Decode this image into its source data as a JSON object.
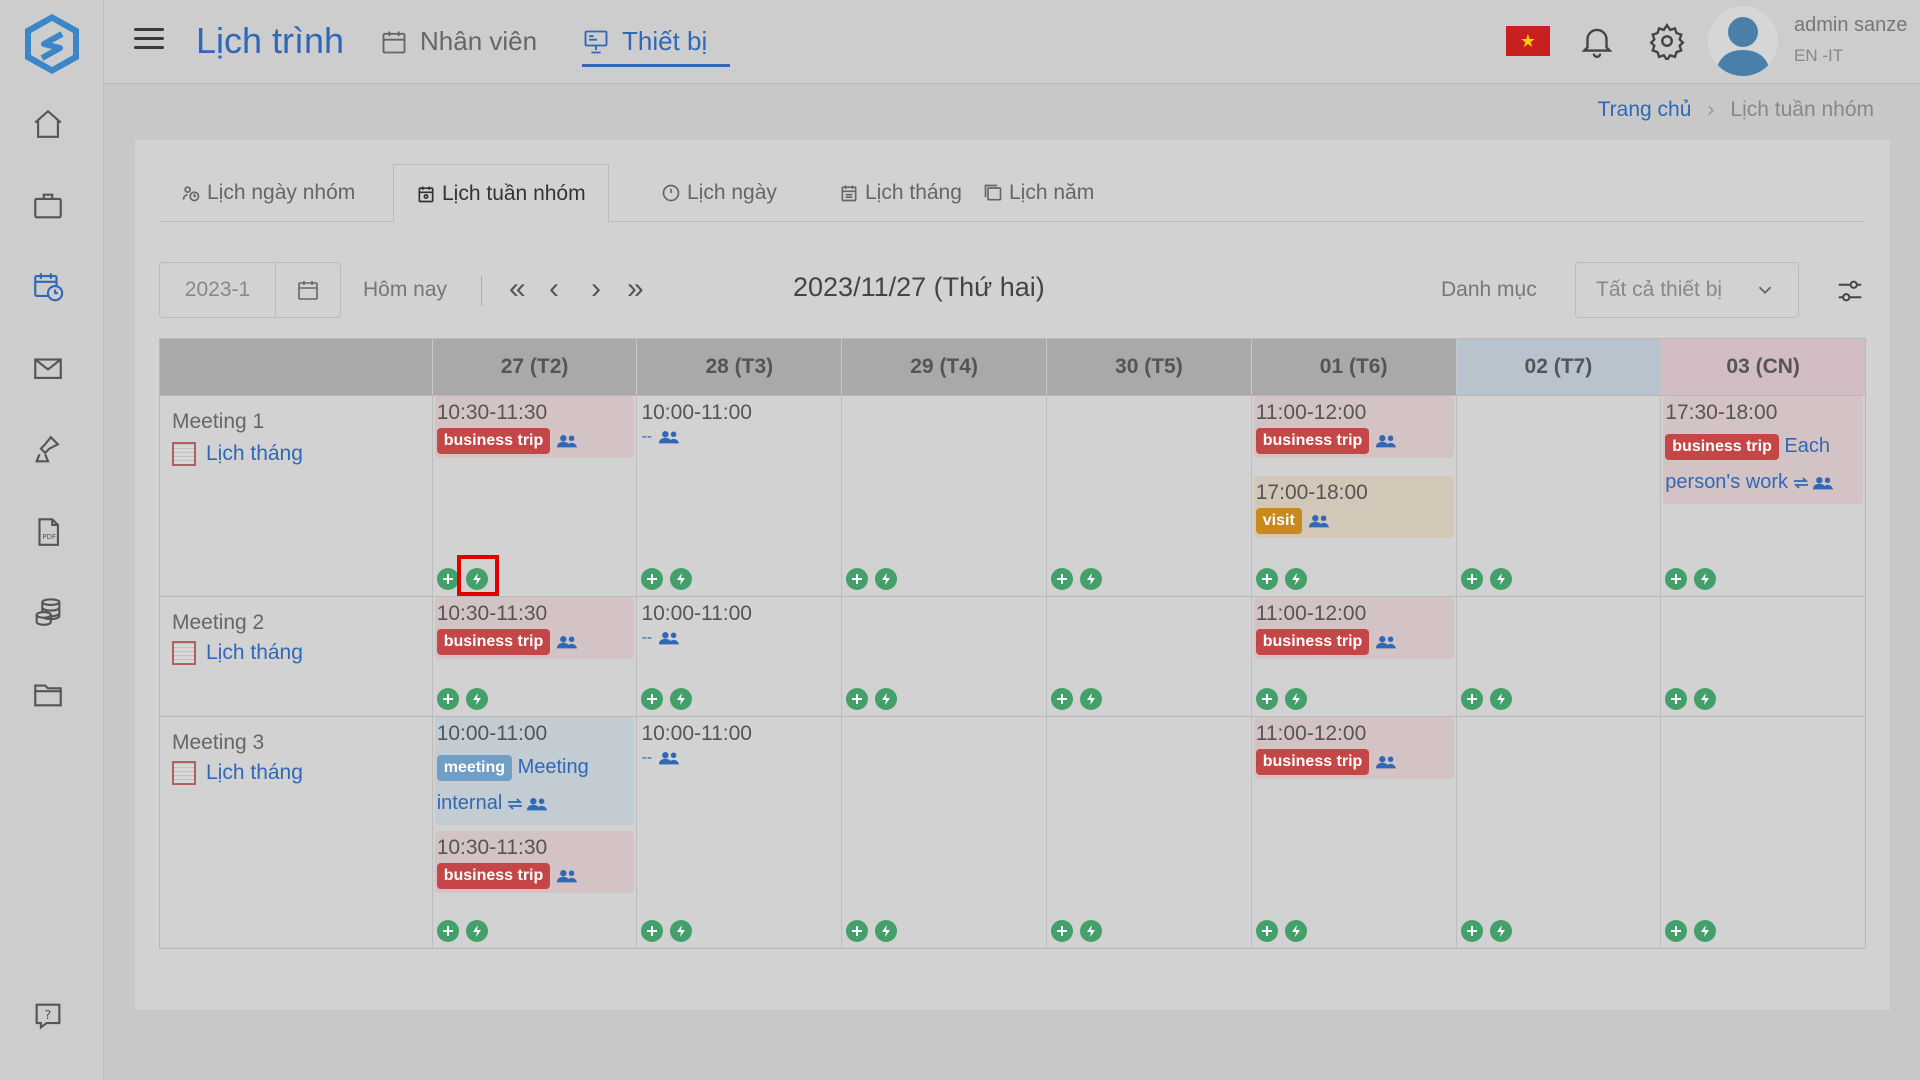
{
  "app": {
    "title": "Lịch trình"
  },
  "header": {
    "tabs": [
      {
        "label": "Nhân viên"
      },
      {
        "label": "Thiết bị"
      }
    ],
    "user": {
      "name": "admin sanze",
      "sub": "EN -IT"
    }
  },
  "breadcrumb": {
    "home": "Trang chủ",
    "current": "Lịch tuần nhóm"
  },
  "view_tabs": [
    {
      "label": "Lịch ngày nhóm"
    },
    {
      "label": "Lịch tuần nhóm"
    },
    {
      "label": "Lịch ngày"
    },
    {
      "label": "Lịch tháng"
    },
    {
      "label": "Lịch năm"
    }
  ],
  "toolbar": {
    "date_value": "2023-1",
    "today": "Hôm nay",
    "current_date": "2023/11/27  (Thứ hai)",
    "category_label": "Danh mục",
    "category_value": "Tất cả thiết bị"
  },
  "grid": {
    "days": [
      {
        "label": "27  (T2)"
      },
      {
        "label": "28  (T3)"
      },
      {
        "label": "29  (T4)"
      },
      {
        "label": "30  (T5)"
      },
      {
        "label": "01  (T6)"
      },
      {
        "label": "02  (T7)"
      },
      {
        "label": "03  (CN)"
      }
    ],
    "rows": [
      {
        "name": "Meeting 1",
        "link": "Lịch tháng",
        "cells": [
          [
            {
              "time": "10:30-11:30",
              "badge": "business trip"
            }
          ],
          [
            {
              "time": "10:00-11:00",
              "text": "--"
            }
          ],
          [],
          [],
          [
            {
              "time": "11:00-12:00",
              "badge": "business trip"
            },
            {
              "time": "17:00-18:00",
              "badge": "visit"
            }
          ],
          [],
          [
            {
              "time": "17:30-18:00",
              "badge": "business trip",
              "text": "Each",
              "text2": "person's work"
            }
          ]
        ]
      },
      {
        "name": "Meeting 2",
        "link": "Lịch tháng",
        "cells": [
          [
            {
              "time": "10:30-11:30",
              "badge": "business trip"
            }
          ],
          [
            {
              "time": "10:00-11:00",
              "text": "--"
            }
          ],
          [],
          [],
          [
            {
              "time": "11:00-12:00",
              "badge": "business trip"
            }
          ],
          [],
          []
        ]
      },
      {
        "name": "Meeting 3",
        "link": "Lịch tháng",
        "cells": [
          [
            {
              "time": "10:00-11:00",
              "badge": "meeting",
              "text": "Meeting",
              "text2": "internal"
            },
            {
              "time": "10:30-11:30",
              "badge": "business trip"
            }
          ],
          [
            {
              "time": "10:00-11:00",
              "text": "--"
            }
          ],
          [],
          [],
          [
            {
              "time": "11:00-12:00",
              "badge": "business trip"
            }
          ],
          [],
          []
        ]
      }
    ]
  },
  "colors": {
    "accent": "#3068b8",
    "trip": "#c54646",
    "visit": "#c88a1a",
    "meeting": "#6f9ec6",
    "action": "#44a06a",
    "highlight": "#e00000"
  }
}
